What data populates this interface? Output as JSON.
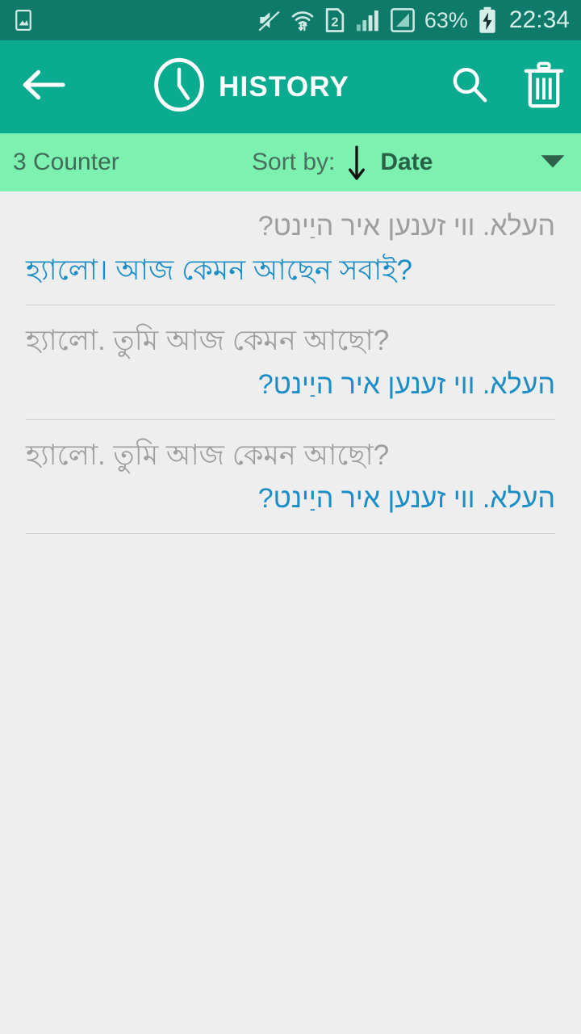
{
  "status_bar": {
    "icons": [
      "image-icon",
      "mute-icon",
      "wifi-transfer-icon",
      "sim2-icon",
      "signal-bars-icon",
      "signal-boxed-icon"
    ],
    "battery_percent": "63%",
    "battery_icon": "battery-charging-icon",
    "time": "22:34",
    "background_color": "#0e7a6a"
  },
  "action_bar": {
    "back_icon": "back-arrow-icon",
    "clock_icon": "clock-icon",
    "title": "HISTORY",
    "search_icon": "search-icon",
    "delete_icon": "trash-icon",
    "background_color": "#0aab8e"
  },
  "sort_bar": {
    "counter": "3 Counter",
    "sort_label": "Sort by:",
    "direction_icon": "down-arrow-icon",
    "sort_value": "Date",
    "dropdown_icon": "caret-down-icon",
    "background_color": "#7df2b0"
  },
  "history": {
    "source_color": "#9e9e9e",
    "target_color": "#1b8ec6",
    "items": [
      {
        "source_text": "העלא. ווי זענען איר היַינט?",
        "source_dir": "rtl",
        "target_text": "হ্যালো। আজ কেমন আছেন সবাই?",
        "target_dir": "ltr"
      },
      {
        "source_text": "হ্যালো. তুমি আজ কেমন আছো?",
        "source_dir": "ltr",
        "target_text": "העלא. ווי זענען איר היַינט?",
        "target_dir": "rtl"
      },
      {
        "source_text": "হ্যালো. তুমি আজ কেমন আছো?",
        "source_dir": "ltr",
        "target_text": "העלא. ווי זענען איר היַינט?",
        "target_dir": "rtl"
      }
    ]
  }
}
